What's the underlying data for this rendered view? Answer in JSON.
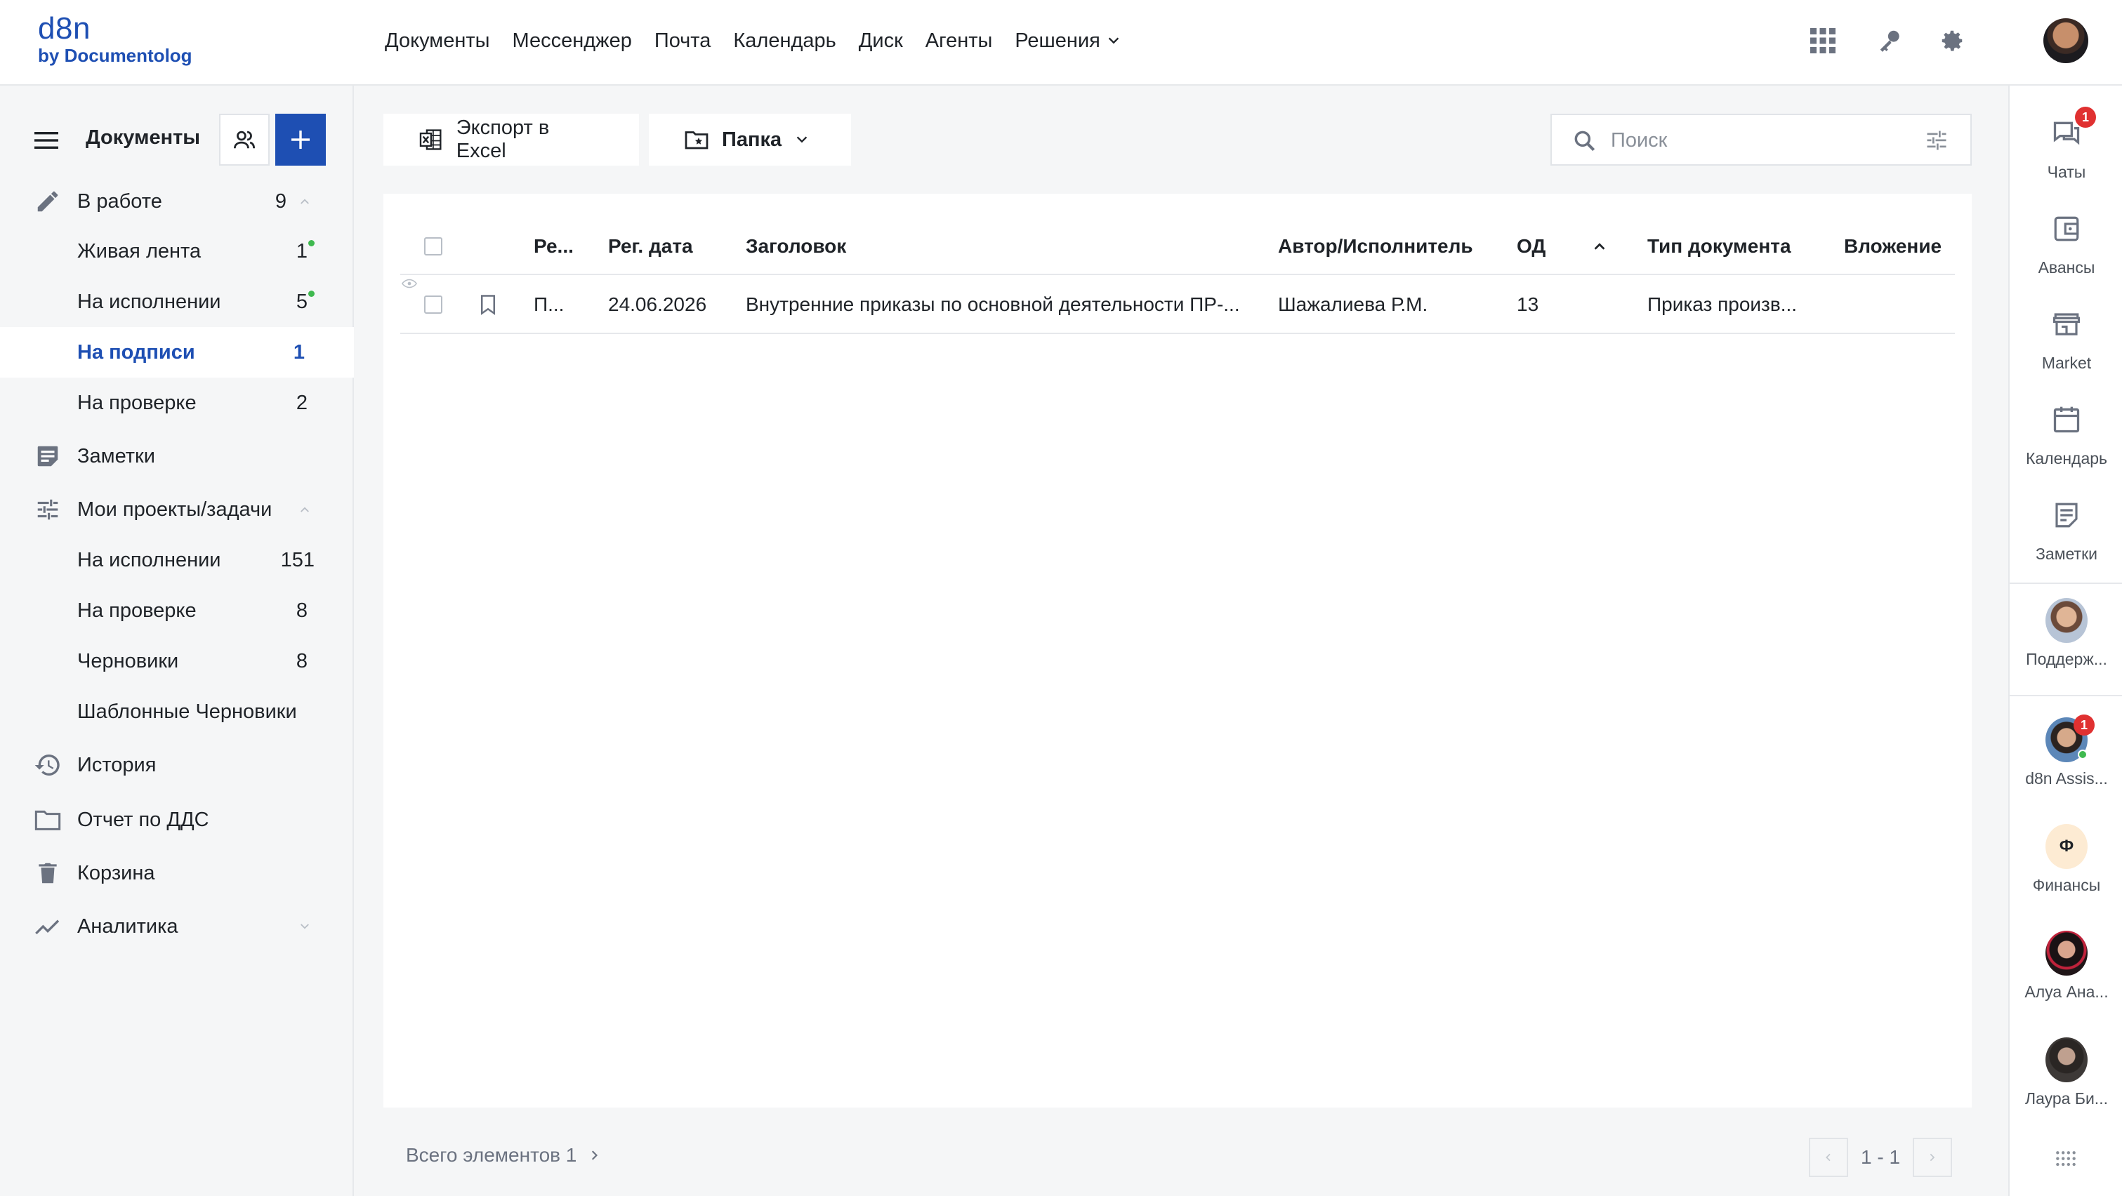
{
  "logo": {
    "main": "d8n",
    "sub": "by Documentolog"
  },
  "topnav": [
    {
      "label": "Документы"
    },
    {
      "label": "Мессенджер"
    },
    {
      "label": "Почта"
    },
    {
      "label": "Календарь"
    },
    {
      "label": "Диск"
    },
    {
      "label": "Агенты"
    },
    {
      "label": "Решения"
    }
  ],
  "sidebar": {
    "title": "Документы",
    "items": [
      {
        "label": "В работе",
        "count": "9",
        "icon": "pencil-icon"
      },
      {
        "label": "Живая лента",
        "count": "1",
        "dot": true
      },
      {
        "label": "На исполнении",
        "count": "5",
        "dot": true
      },
      {
        "label": "На подписи",
        "count": "1",
        "active": true
      },
      {
        "label": "На проверке",
        "count": "2"
      },
      {
        "label": "Заметки",
        "icon": "notes-icon"
      },
      {
        "label": "Мои проекты/задачи",
        "icon": "tune-icon"
      },
      {
        "label": "На исполнении",
        "count": "151"
      },
      {
        "label": "На проверке",
        "count": "8"
      },
      {
        "label": "Черновики",
        "count": "8"
      },
      {
        "label": "Шаблонные Черновики"
      },
      {
        "label": "История",
        "icon": "history-icon"
      },
      {
        "label": "Отчет по ДДС",
        "icon": "folder-icon"
      },
      {
        "label": "Корзина",
        "icon": "trash-icon"
      },
      {
        "label": "Аналитика",
        "icon": "analytics-icon"
      }
    ]
  },
  "toolbar": {
    "export_label": "Экспорт в Excel",
    "folder_label": "Папка",
    "search_placeholder": "Поиск"
  },
  "table": {
    "headers": {
      "reg": "Ре...",
      "reg_date": "Рег. дата",
      "title": "Заголовок",
      "author": "Автор/Исполнитель",
      "od": "ОД",
      "doc_type": "Тип документа",
      "attachment": "Вложение"
    },
    "rows": [
      {
        "reg": "П...",
        "reg_date": "24.06.2026",
        "title": "Внутренние приказы по основной деятельности ПР-...",
        "author": "Шажалиева Р.М.",
        "od": "13",
        "doc_type": "Приказ произв...",
        "attachment": ""
      }
    ]
  },
  "footer": {
    "total_label": "Всего элементов 1",
    "range": "1 - 1"
  },
  "rail": {
    "items": [
      {
        "label": "Чаты",
        "badge": "1"
      },
      {
        "label": "Авансы"
      },
      {
        "label": "Market"
      },
      {
        "label": "Календарь"
      },
      {
        "label": "Заметки"
      }
    ],
    "contacts": [
      {
        "label": "Поддерж..."
      },
      {
        "label": "d8n Assis...",
        "badge": "1"
      },
      {
        "label": "Финансы",
        "initial": "Ф"
      },
      {
        "label": "Алуа Ана..."
      },
      {
        "label": "Лаура Би..."
      }
    ]
  },
  "colors": {
    "accent": "#1e4fb3",
    "badge": "#e03131",
    "online": "#3fb94f"
  }
}
